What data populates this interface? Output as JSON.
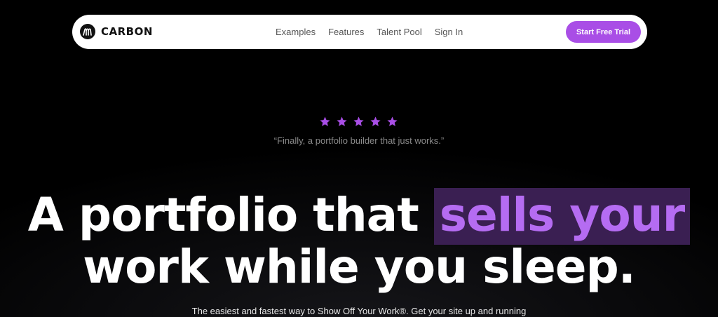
{
  "brand": {
    "name": "CARBON",
    "mark_letter": "m"
  },
  "nav": {
    "links": [
      "Examples",
      "Features",
      "Talent Pool",
      "Sign In"
    ],
    "cta_label": "Start Free Trial"
  },
  "hero": {
    "rating_stars": 5,
    "quote": "“Finally, a portfolio builder that just works.”",
    "headline_part1": "A portfolio that ",
    "headline_highlight": "sells your",
    "headline_line2": "work while you sleep.",
    "subheadline": "The easiest and fastest way to Show Off Your Work®. Get your site up and running"
  },
  "colors": {
    "accent": "#a94ee6",
    "highlight_text": "#b56cf2",
    "highlight_bg": "#3a1f52",
    "star": "#a94ee6",
    "background": "#000000"
  }
}
